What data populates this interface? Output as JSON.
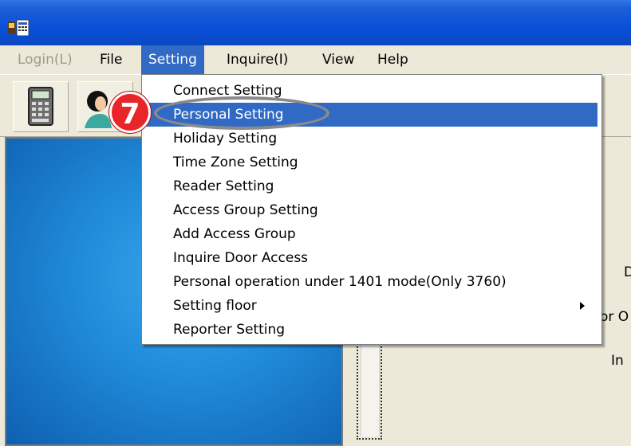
{
  "menubar": {
    "items": [
      {
        "label": "Login(L)",
        "state": "disabled"
      },
      {
        "label": "File",
        "state": "normal"
      },
      {
        "label": "Setting",
        "state": "active"
      },
      {
        "label": "Inquire(I)",
        "state": "normal"
      },
      {
        "label": "View",
        "state": "normal"
      },
      {
        "label": "Help",
        "state": "normal"
      }
    ]
  },
  "setting_menu": {
    "items": [
      {
        "label": "Connect Setting"
      },
      {
        "label": "Personal Setting",
        "highlighted": true
      },
      {
        "label": "Holiday Setting"
      },
      {
        "label": "Time Zone Setting"
      },
      {
        "label": "Reader Setting"
      },
      {
        "label": "Access Group Setting"
      },
      {
        "label": "Add Access Group"
      },
      {
        "label": "Inquire Door Access"
      },
      {
        "label": "Personal operation under 1401 mode(Only 3760)"
      },
      {
        "label": "Setting floor",
        "has_submenu": true
      },
      {
        "label": "Reporter Setting"
      }
    ]
  },
  "callout": {
    "step_number": "7"
  },
  "right_panel": {
    "fragments": [
      "D",
      "or O",
      "In"
    ]
  },
  "colors": {
    "titlebar": "#0a50d8",
    "menu_highlight": "#316ac5",
    "step_badge": "#e8262a",
    "window_bg": "#ece9d8"
  },
  "icons": [
    "app-icon",
    "calculator-icon",
    "person-icon",
    "submenu-arrow-icon"
  ]
}
